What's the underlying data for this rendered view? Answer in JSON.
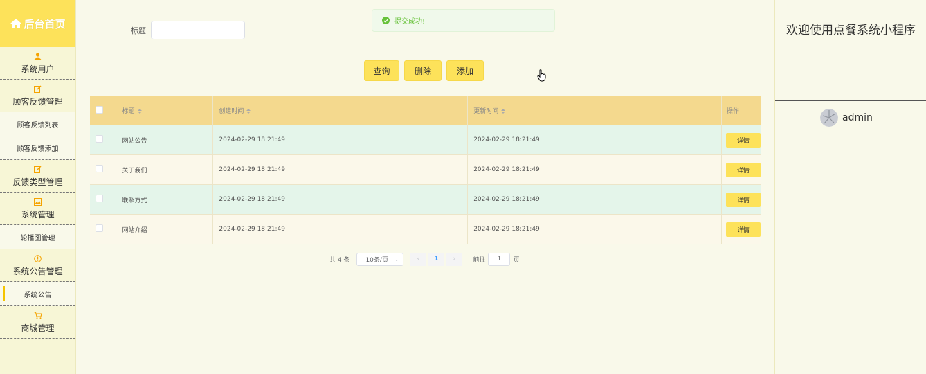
{
  "sidebar": {
    "home_label": "后台首页",
    "groups": [
      {
        "label": "系统用户",
        "icon": "user-icon",
        "subs": []
      },
      {
        "label": "顾客反馈管理",
        "icon": "edit-icon",
        "subs": [
          "顾客反馈列表",
          "顾客反馈添加"
        ]
      },
      {
        "label": "反馈类型管理",
        "icon": "edit-icon",
        "subs": []
      },
      {
        "label": "系统管理",
        "icon": "image-icon",
        "subs": [
          "轮播图管理"
        ]
      },
      {
        "label": "系统公告管理",
        "icon": "info-icon",
        "subs": [
          "系统公告"
        ]
      },
      {
        "label": "商城管理",
        "icon": "cart-icon",
        "subs": []
      }
    ],
    "active_sub": "系统公告",
    "accent": "#fde25a"
  },
  "search": {
    "label": "标题",
    "value": "",
    "placeholder": ""
  },
  "toast": {
    "message": "提交成功!",
    "color": "#67c23a"
  },
  "toolbar": {
    "query_label": "查询",
    "delete_label": "删除",
    "add_label": "添加"
  },
  "table": {
    "headers": {
      "title": "标题",
      "created": "创建时间",
      "updated": "更新时间",
      "actions": "操作"
    },
    "rows": [
      {
        "title": "网站公告",
        "created": "2024-02-29 18:21:49",
        "updated": "2024-02-29 18:21:49",
        "action": "详情"
      },
      {
        "title": "关于我们",
        "created": "2024-02-29 18:21:49",
        "updated": "2024-02-29 18:21:49",
        "action": "详情"
      },
      {
        "title": "联系方式",
        "created": "2024-02-29 18:21:49",
        "updated": "2024-02-29 18:21:49",
        "action": "详情"
      },
      {
        "title": "网站介绍",
        "created": "2024-02-29 18:21:49",
        "updated": "2024-02-29 18:21:49",
        "action": "详情"
      }
    ]
  },
  "pagination": {
    "total_text": "共 4 条",
    "page_size": "10条/页",
    "current_page": "1",
    "goto_label": "前往",
    "goto_value": "1",
    "page_suffix": "页"
  },
  "right": {
    "welcome": "欢迎使用点餐系统小程序",
    "username": "admin"
  }
}
